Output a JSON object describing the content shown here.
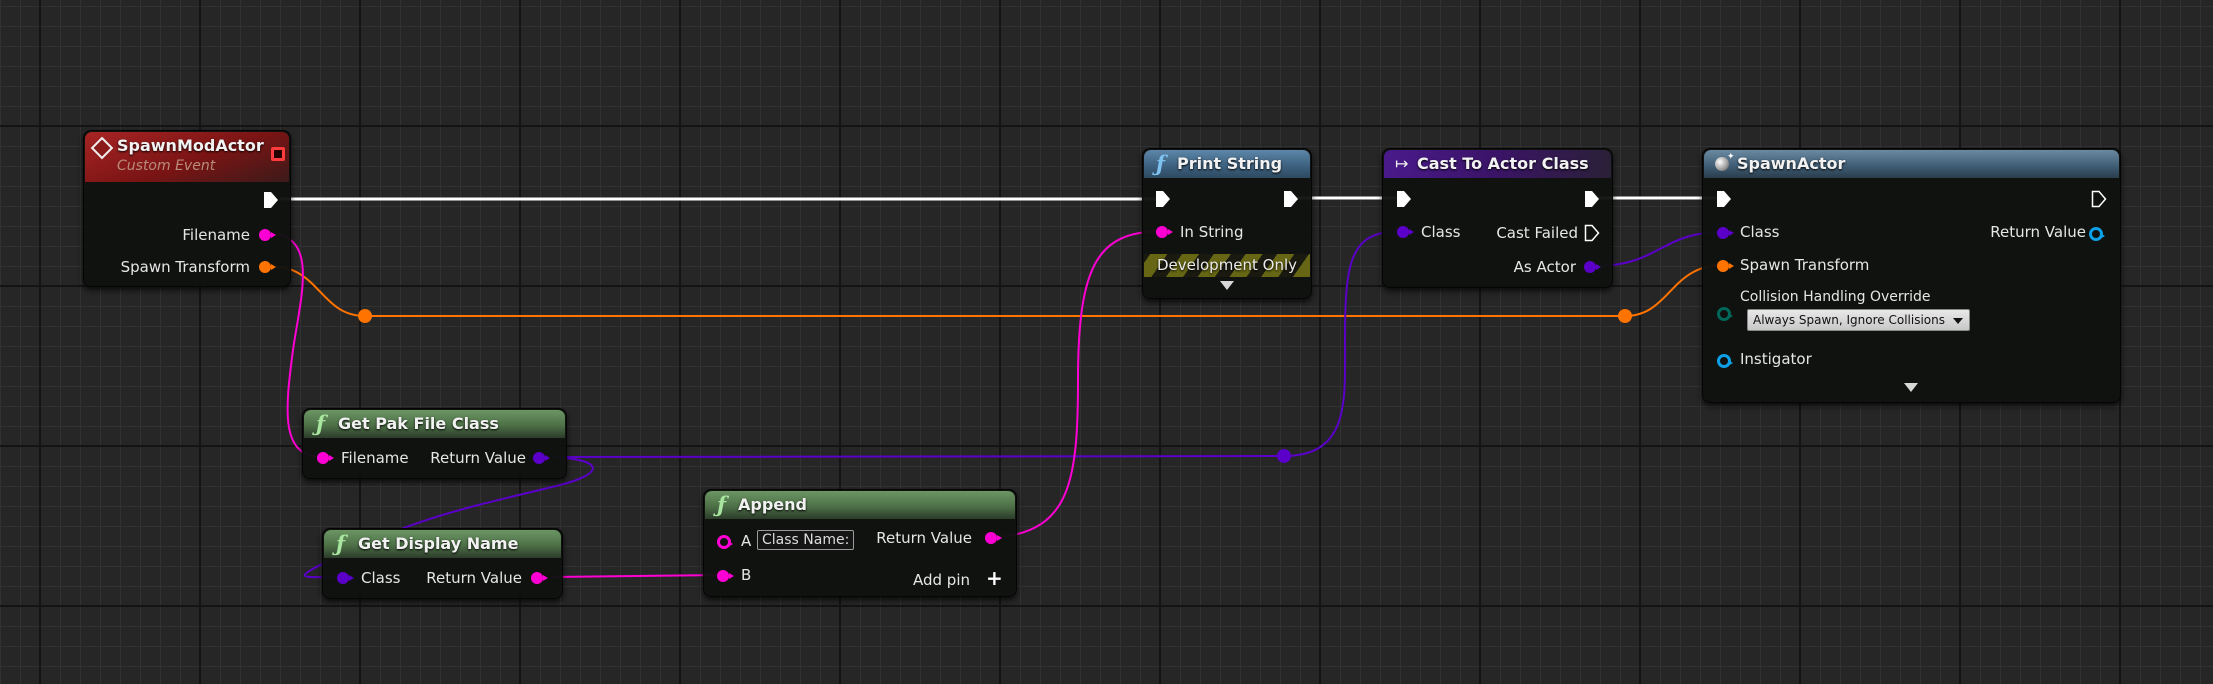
{
  "app": "Unreal Engine Blueprint Editor",
  "colors": {
    "background": "#262626",
    "exec_wire": "#ffffff",
    "string_pin": "#ff00d4",
    "class_pin": "#5a00c8",
    "transform_pin": "#ff7300",
    "object_pin": "#0da0e6",
    "enum_pin": "#00685a",
    "event_header": "#9e1b1b",
    "function_pure_header": "#5c8a55",
    "function_header": "#4b7192",
    "cast_header": "#3f1676"
  },
  "nodes": {
    "spawn_mod_actor": {
      "title": "SpawnModActor",
      "subtitle": "Custom Event",
      "icon": "event-diamond-icon",
      "outputs": [
        "Filename",
        "Spawn Transform"
      ]
    },
    "print_string": {
      "title": "Print String",
      "icon": "function-icon",
      "inputs": [
        "In String"
      ],
      "dev_only_label": "Development Only"
    },
    "cast_to_actor_class": {
      "title": "Cast To Actor Class",
      "icon": "cast-arrow-icon",
      "inputs": [
        "Class"
      ],
      "outputs": [
        "Cast Failed",
        "As Actor"
      ]
    },
    "spawn_actor": {
      "title": "SpawnActor",
      "icon": "spawn-bomb-icon",
      "inputs": [
        "Class",
        "Spawn Transform",
        "Collision Handling Override",
        "Instigator"
      ],
      "outputs": [
        "Return Value"
      ],
      "collision_value": "Always Spawn, Ignore Collisions"
    },
    "get_pak_file_class": {
      "title": "Get Pak File Class",
      "icon": "function-icon",
      "inputs": [
        "Filename"
      ],
      "outputs": [
        "Return Value"
      ]
    },
    "get_display_name": {
      "title": "Get Display Name",
      "icon": "function-icon",
      "inputs": [
        "Class"
      ],
      "outputs": [
        "Return Value"
      ]
    },
    "append": {
      "title": "Append",
      "icon": "function-icon",
      "input_a": "A",
      "input_a_value": "Class Name:",
      "input_b": "B",
      "outputs": [
        "Return Value"
      ],
      "add_pin_label": "Add pin"
    }
  }
}
